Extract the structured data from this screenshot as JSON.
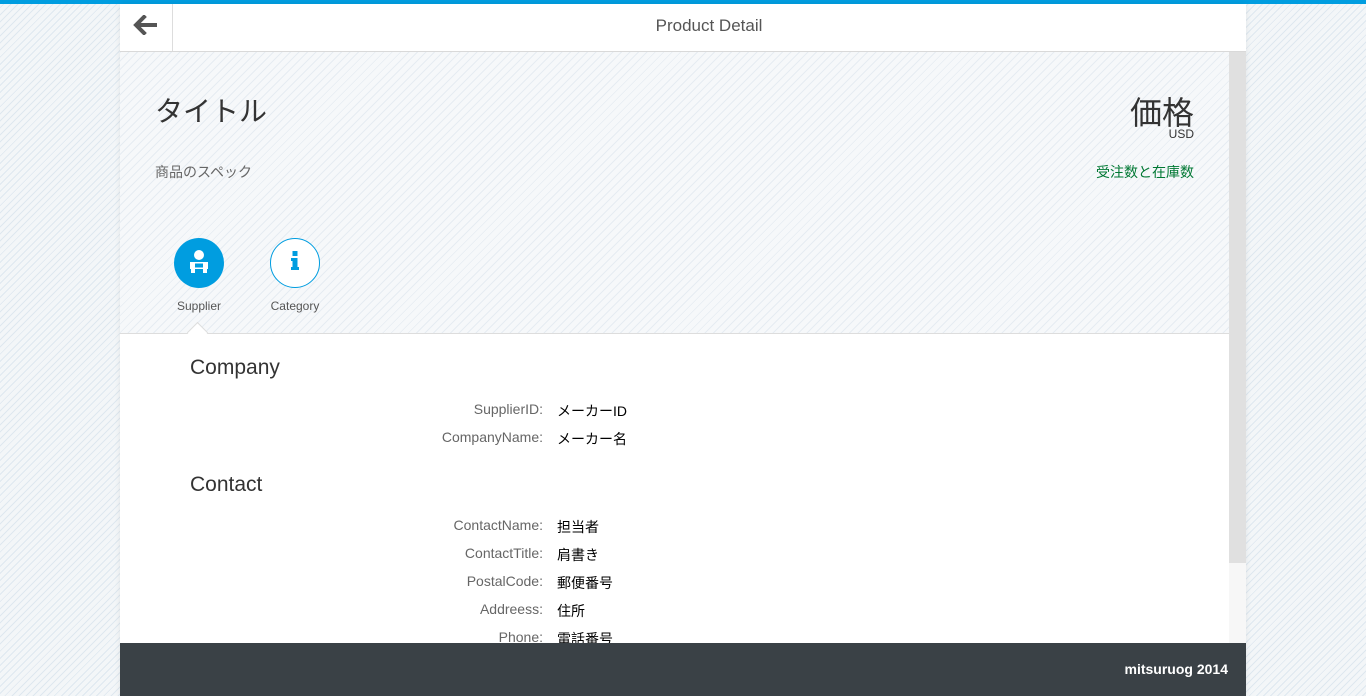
{
  "header": {
    "title": "Product Detail",
    "back_icon": "arrow-left-icon"
  },
  "object_header": {
    "title": "タイトル",
    "number": "価格",
    "number_unit": "USD",
    "attribute": "商品のスペック",
    "status": "受注数と在庫数",
    "status_color": "#007833"
  },
  "tabs": [
    {
      "label": "Supplier",
      "icon": "person-icon",
      "selected": true
    },
    {
      "label": "Category",
      "icon": "info-icon",
      "selected": false
    }
  ],
  "sections": {
    "company": {
      "title": "Company",
      "fields": [
        {
          "label": "SupplierID:",
          "value": "メーカーID"
        },
        {
          "label": "CompanyName:",
          "value": "メーカー名"
        }
      ]
    },
    "contact": {
      "title": "Contact",
      "fields": [
        {
          "label": "ContactName:",
          "value": "担当者"
        },
        {
          "label": "ContactTitle:",
          "value": "肩書き"
        },
        {
          "label": "PostalCode:",
          "value": "郵便番号"
        },
        {
          "label": "Addreess:",
          "value": "住所"
        },
        {
          "label": "Phone:",
          "value": "電話番号"
        }
      ]
    }
  },
  "footer": {
    "text": "mitsuruog 2014"
  },
  "colors": {
    "accent": "#009de0",
    "footer_bg": "#3a4146"
  }
}
